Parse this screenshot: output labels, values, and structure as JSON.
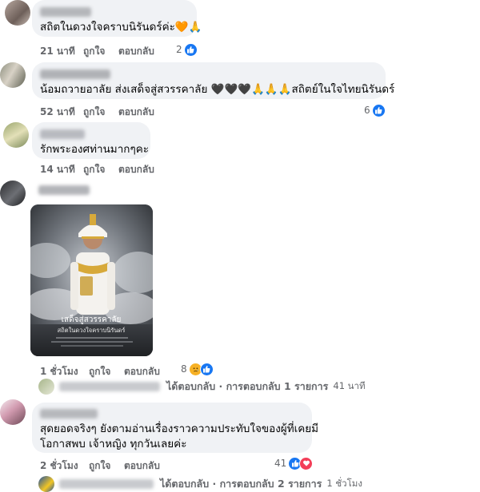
{
  "comments": [
    {
      "text": "สถิตในดวงใจคราบนิรันดร์ค่ะ",
      "emoji": "🧡🙏",
      "time": "21 นาที",
      "like_label": "ถูกใจ",
      "reply_label": "ตอบกลับ",
      "reaction_count": "2"
    },
    {
      "text": "น้อมถวายอาลัย ส่งเสด็จสู่สวรรคาลัย 🖤🖤🖤🙏🙏🙏สถิตย์ในใจไทยนิรันดร์",
      "time": "52 นาที",
      "like_label": "ถูกใจ",
      "reply_label": "ตอบกลับ",
      "reaction_count": "6"
    },
    {
      "text": "รักพระองศท่านมากๆคะ",
      "time": "14 นาที",
      "like_label": "ถูกใจ",
      "reply_label": "ตอบกลับ"
    },
    {
      "image_caption": "เสด็จสู่สวรรคาลัย",
      "image_subcaption": "สถิตในดวงใจคราบนิรันดร์",
      "time": "1 ชั่วโมง",
      "like_label": "ถูกใจ",
      "reply_label": "ตอบกลับ",
      "reaction_count": "8",
      "reply_summary": "ได้ตอบกลับ · การตอบกลับ 1 รายการ",
      "reply_time": "41 นาที"
    },
    {
      "text_line1": "สุดยอดจริงๆ ยังตามอ่านเรื่องราวความประทับใจของผู้ที่เคยมี",
      "text_line2": "โอกาสพบ เจ้าหญิง ทุกวันเลยค่ะ",
      "time": "2 ชั่วโมง",
      "like_label": "ถูกใจ",
      "reply_label": "ตอบกลับ",
      "reaction_count": "41",
      "reply_summary": "ได้ตอบกลับ · การตอบกลับ 2 รายการ",
      "reply_time": "1 ชั่วโมง"
    }
  ],
  "colors": {
    "bubble": "#f0f2f5",
    "meta_text": "#65676b",
    "like_blue": "#1877f2",
    "love_red": "#f33e58"
  }
}
